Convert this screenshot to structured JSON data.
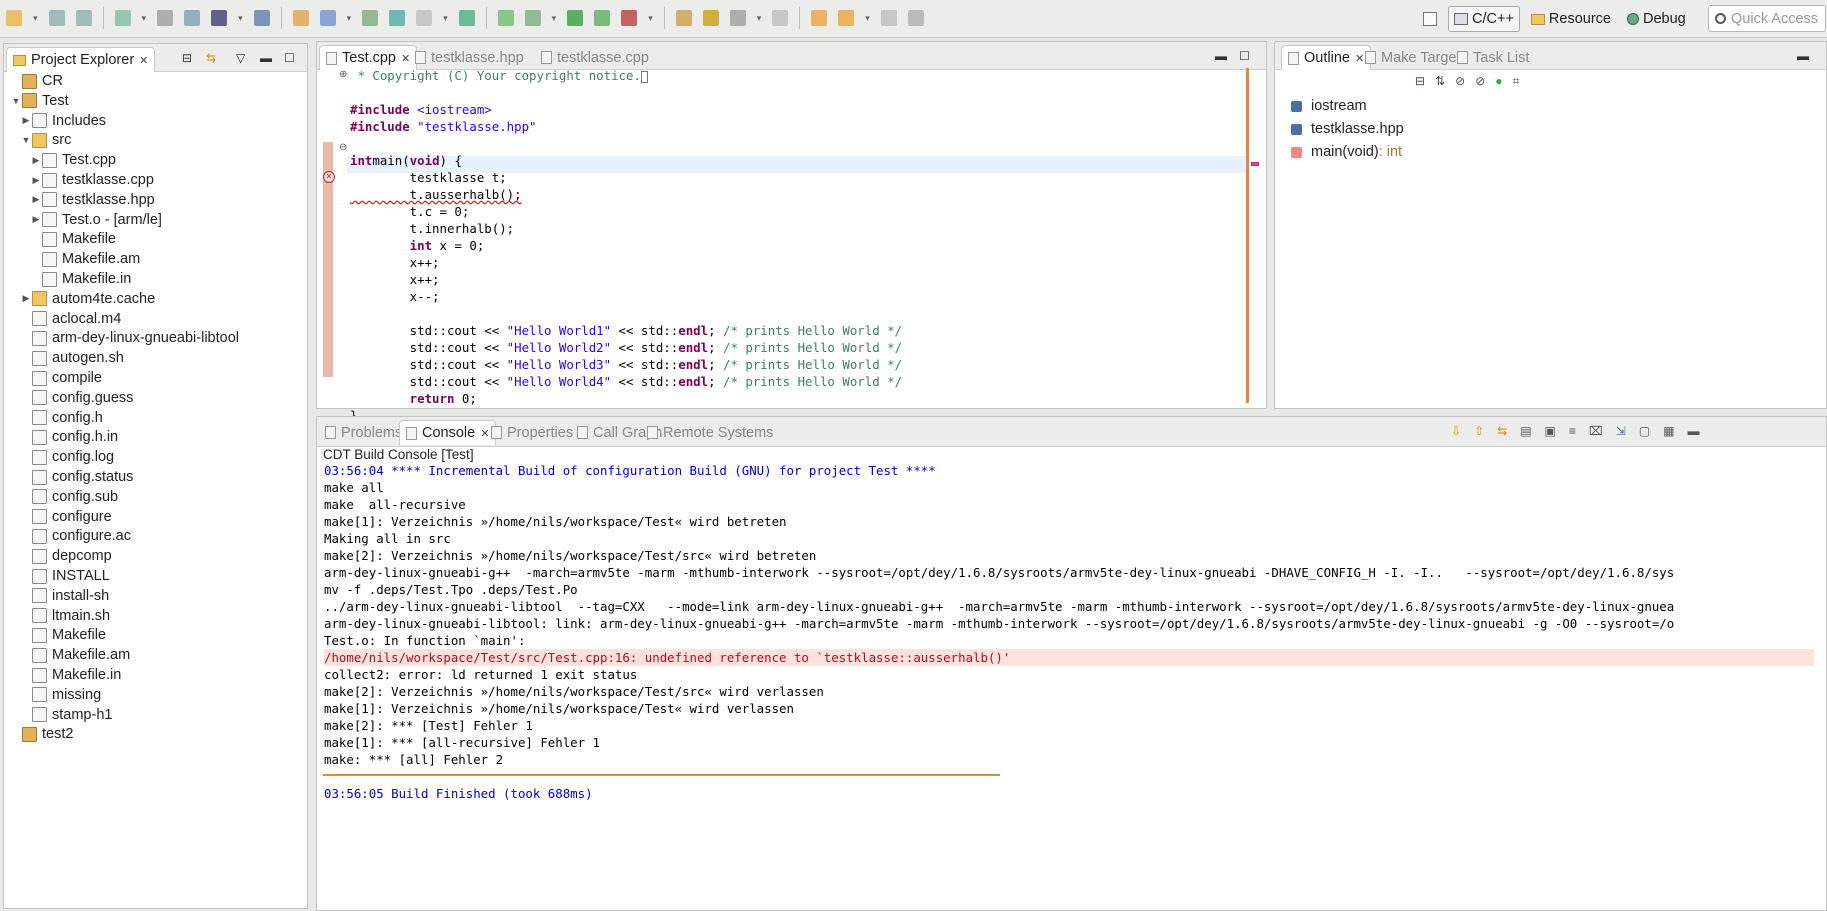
{
  "toolbar": {
    "icons": [
      "new-icon",
      "save-icon",
      "save-all-icon",
      "build-icon",
      "hammer-icon",
      "binary-icon",
      "terminal-icon",
      "skip-icon",
      "open-folder-icon",
      "open-icon",
      "gear-icon",
      "new-class-icon",
      "new-file-icon",
      "new-source-icon",
      "refresh-icon",
      "debug-icon",
      "run-icon",
      "coverage-icon",
      "stop-icon",
      "open-type-icon",
      "search-icon",
      "annotation-icon",
      "next-icon",
      "prev-icon",
      "back-icon",
      "forward-icon",
      "pin-icon"
    ]
  },
  "perspectives": {
    "open_label": "",
    "cpp": "C/C++",
    "resource": "Resource",
    "debug": "Debug",
    "quick_access": "Quick Access"
  },
  "project_explorer": {
    "title": "Project Explorer",
    "items": [
      {
        "label": "CR",
        "depth": 0,
        "arrow": "",
        "icon": "project-icon"
      },
      {
        "label": "Test",
        "depth": 0,
        "arrow": "down",
        "icon": "project-icon"
      },
      {
        "label": "Includes",
        "depth": 1,
        "arrow": "right",
        "icon": "includes-icon"
      },
      {
        "label": "src",
        "depth": 1,
        "arrow": "down",
        "icon": "source-folder-icon"
      },
      {
        "label": "Test.cpp",
        "depth": 2,
        "arrow": "right",
        "icon": "cpp-file-icon"
      },
      {
        "label": "testklasse.cpp",
        "depth": 2,
        "arrow": "right",
        "icon": "cpp-file-icon"
      },
      {
        "label": "testklasse.hpp",
        "depth": 2,
        "arrow": "right",
        "icon": "header-file-icon"
      },
      {
        "label": "Test.o - [arm/le]",
        "depth": 2,
        "arrow": "right",
        "icon": "binary-file-icon"
      },
      {
        "label": "Makefile",
        "depth": 2,
        "arrow": "",
        "icon": "makefile-icon"
      },
      {
        "label": "Makefile.am",
        "depth": 2,
        "arrow": "",
        "icon": "automake-icon"
      },
      {
        "label": "Makefile.in",
        "depth": 2,
        "arrow": "",
        "icon": "automake-icon"
      },
      {
        "label": "autom4te.cache",
        "depth": 1,
        "arrow": "right",
        "icon": "folder-icon"
      },
      {
        "label": "aclocal.m4",
        "depth": 1,
        "arrow": "",
        "icon": "autoconf-icon"
      },
      {
        "label": "arm-dey-linux-gnueabi-libtool",
        "depth": 1,
        "arrow": "",
        "icon": "file-icon"
      },
      {
        "label": "autogen.sh",
        "depth": 1,
        "arrow": "",
        "icon": "file-icon"
      },
      {
        "label": "compile",
        "depth": 1,
        "arrow": "",
        "icon": "script-icon"
      },
      {
        "label": "config.guess",
        "depth": 1,
        "arrow": "",
        "icon": "script-icon"
      },
      {
        "label": "config.h",
        "depth": 1,
        "arrow": "",
        "icon": "header-file-icon"
      },
      {
        "label": "config.h.in",
        "depth": 1,
        "arrow": "",
        "icon": "file-icon"
      },
      {
        "label": "config.log",
        "depth": 1,
        "arrow": "",
        "icon": "file-icon"
      },
      {
        "label": "config.status",
        "depth": 1,
        "arrow": "",
        "icon": "file-icon"
      },
      {
        "label": "config.sub",
        "depth": 1,
        "arrow": "",
        "icon": "script-icon"
      },
      {
        "label": "configure",
        "depth": 1,
        "arrow": "",
        "icon": "file-icon"
      },
      {
        "label": "configure.ac",
        "depth": 1,
        "arrow": "",
        "icon": "autoconf-icon"
      },
      {
        "label": "depcomp",
        "depth": 1,
        "arrow": "",
        "icon": "script-icon"
      },
      {
        "label": "INSTALL",
        "depth": 1,
        "arrow": "",
        "icon": "file-icon"
      },
      {
        "label": "install-sh",
        "depth": 1,
        "arrow": "",
        "icon": "script-icon"
      },
      {
        "label": "ltmain.sh",
        "depth": 1,
        "arrow": "",
        "icon": "script-icon"
      },
      {
        "label": "Makefile",
        "depth": 1,
        "arrow": "",
        "icon": "makefile-icon"
      },
      {
        "label": "Makefile.am",
        "depth": 1,
        "arrow": "",
        "icon": "automake-icon"
      },
      {
        "label": "Makefile.in",
        "depth": 1,
        "arrow": "",
        "icon": "automake-icon"
      },
      {
        "label": "missing",
        "depth": 1,
        "arrow": "",
        "icon": "file-icon"
      },
      {
        "label": "stamp-h1",
        "depth": 1,
        "arrow": "",
        "icon": "file-icon"
      },
      {
        "label": "test2",
        "depth": 0,
        "arrow": "",
        "icon": "project-icon"
      }
    ]
  },
  "editor": {
    "tabs": [
      {
        "label": "Test.cpp",
        "active": true
      },
      {
        "label": "testklasse.hpp",
        "active": false
      },
      {
        "label": "testklasse.cpp",
        "active": false
      }
    ],
    "lines": [
      [
        [
          "cmt",
          " * Copyright (C) Your copyright notice."
        ]
      ],
      [],
      [
        [
          "pp",
          "#include "
        ],
        [
          "str",
          "<iostream>"
        ]
      ],
      [
        [
          "pp",
          "#include "
        ],
        [
          "str",
          "\"testklasse.hpp\""
        ]
      ],
      [],
      [
        [
          "kw",
          "int"
        ],
        [
          "",
          "main("
        ],
        [
          "kw",
          "void"
        ],
        [
          "",
          ") {"
        ]
      ],
      [
        [
          "",
          "        testklasse t;"
        ]
      ],
      [
        [
          "",
          "        t.ausserhalb();"
        ]
      ],
      [
        [
          "",
          "        t.c = 0;"
        ]
      ],
      [
        [
          "",
          "        t.innerhalb();"
        ]
      ],
      [
        [
          "kw",
          "        int"
        ],
        [
          "",
          " x = 0;"
        ]
      ],
      [
        [
          "",
          "        x++;"
        ]
      ],
      [
        [
          "",
          "        x++;"
        ]
      ],
      [
        [
          "",
          "        x--;"
        ]
      ],
      [],
      [
        [
          "",
          "        std::cout << "
        ],
        [
          "str",
          "\"Hello World1\""
        ],
        [
          "",
          " << std::"
        ],
        [
          "kw",
          "endl"
        ],
        [
          "",
          "; "
        ],
        [
          "cmt",
          "/* prints Hello World */"
        ]
      ],
      [
        [
          "",
          "        std::cout << "
        ],
        [
          "str",
          "\"Hello World2\""
        ],
        [
          "",
          " << std::"
        ],
        [
          "kw",
          "endl"
        ],
        [
          "",
          "; "
        ],
        [
          "cmt",
          "/* prints Hello World */"
        ]
      ],
      [
        [
          "",
          "        std::cout << "
        ],
        [
          "str",
          "\"Hello World3\""
        ],
        [
          "",
          " << std::"
        ],
        [
          "kw",
          "endl"
        ],
        [
          "",
          "; "
        ],
        [
          "cmt",
          "/* prints Hello World */"
        ]
      ],
      [
        [
          "",
          "        std::cout << "
        ],
        [
          "str",
          "\"Hello World4\""
        ],
        [
          "",
          " << std::"
        ],
        [
          "kw",
          "endl"
        ],
        [
          "",
          "; "
        ],
        [
          "cmt",
          "/* prints Hello World */"
        ]
      ],
      [
        [
          "kw",
          "        return"
        ],
        [
          "",
          " 0;"
        ]
      ],
      [
        [
          "",
          "}"
        ]
      ]
    ]
  },
  "outline": {
    "tabs": [
      {
        "label": "Outline",
        "active": true
      },
      {
        "label": "Make Target",
        "active": false
      },
      {
        "label": "Task List",
        "active": false
      }
    ],
    "items": [
      {
        "label": "iostream",
        "type": ""
      },
      {
        "label": "testklasse.hpp",
        "type": ""
      },
      {
        "label": "main(void)",
        "type": " : int"
      }
    ]
  },
  "console": {
    "tabs": [
      {
        "label": "Problems",
        "active": false
      },
      {
        "label": "Console",
        "active": true
      },
      {
        "label": "Properties",
        "active": false
      },
      {
        "label": "Call Graph",
        "active": false
      },
      {
        "label": "Remote Systems",
        "active": false
      }
    ],
    "title": "CDT Build Console [Test]",
    "lines": [
      {
        "t": "03:56:04 **** Incremental Build of configuration Build (GNU) for project Test ****",
        "c": "info"
      },
      {
        "t": "make all",
        "c": ""
      },
      {
        "t": "make  all-recursive",
        "c": ""
      },
      {
        "t": "make[1]: Verzeichnis »/home/nils/workspace/Test« wird betreten",
        "c": ""
      },
      {
        "t": "Making all in src",
        "c": ""
      },
      {
        "t": "make[2]: Verzeichnis »/home/nils/workspace/Test/src« wird betreten",
        "c": ""
      },
      {
        "t": "arm-dey-linux-gnueabi-g++  -march=armv5te -marm -mthumb-interwork --sysroot=/opt/dey/1.6.8/sysroots/armv5te-dey-linux-gnueabi -DHAVE_CONFIG_H -I. -I..   --sysroot=/opt/dey/1.6.8/sys",
        "c": ""
      },
      {
        "t": "mv -f .deps/Test.Tpo .deps/Test.Po",
        "c": ""
      },
      {
        "t": "../arm-dey-linux-gnueabi-libtool  --tag=CXX   --mode=link arm-dey-linux-gnueabi-g++  -march=armv5te -marm -mthumb-interwork --sysroot=/opt/dey/1.6.8/sysroots/armv5te-dey-linux-gnuea",
        "c": ""
      },
      {
        "t": "arm-dey-linux-gnueabi-libtool: link: arm-dey-linux-gnueabi-g++ -march=armv5te -marm -mthumb-interwork --sysroot=/opt/dey/1.6.8/sysroots/armv5te-dey-linux-gnueabi -g -O0 --sysroot=/o",
        "c": ""
      },
      {
        "t": "Test.o: In function `main':",
        "c": ""
      },
      {
        "t": "/home/nils/workspace/Test/src/Test.cpp:16: undefined reference to `testklasse::ausserhalb()'",
        "c": "err"
      },
      {
        "t": "collect2: error: ld returned 1 exit status",
        "c": ""
      },
      {
        "t": "make[2]: Verzeichnis »/home/nils/workspace/Test/src« wird verlassen",
        "c": ""
      },
      {
        "t": "make[1]: Verzeichnis »/home/nils/workspace/Test« wird verlassen",
        "c": ""
      },
      {
        "t": "make[2]: *** [Test] Fehler 1",
        "c": ""
      },
      {
        "t": "make[1]: *** [all-recursive] Fehler 1",
        "c": ""
      },
      {
        "t": "make: *** [all] Fehler 2",
        "c": ""
      },
      {
        "t": "",
        "c": ""
      },
      {
        "t": "03:56:05 Build Finished (took 688ms)",
        "c": "info"
      }
    ]
  },
  "colors": {
    "accent": "#e6863a",
    "error": "#cc2222",
    "info": "#0000cc",
    "errbg": "#fde1dc"
  }
}
